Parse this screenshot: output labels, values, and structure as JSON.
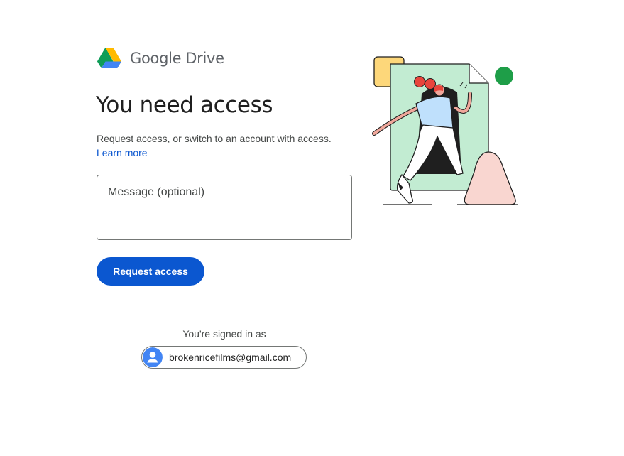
{
  "brand": {
    "google_word": "Google",
    "product_word": "Drive"
  },
  "main": {
    "title": "You need access",
    "description": "Request access, or switch to an account with access.",
    "learn_more": "Learn more",
    "message_placeholder": "Message (optional)",
    "message_value": "",
    "request_button_label": "Request access"
  },
  "account": {
    "signed_in_label": "You're signed in as",
    "email": "brokenricefilms@gmail.com",
    "avatar_icon": "account-circle-icon"
  },
  "colors": {
    "primary": "#0b57d0",
    "drive_green": "#0f9d58",
    "drive_yellow": "#ffba00",
    "drive_blue": "#4285f4",
    "avatar_blue": "#4285f4"
  }
}
